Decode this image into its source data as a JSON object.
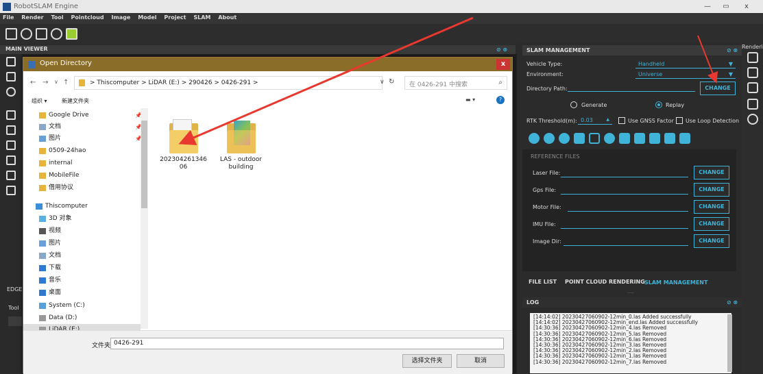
{
  "app": {
    "window_title": "RobotSLAM Engine",
    "window_buttons": {
      "minimize": "—",
      "restore": "▭",
      "close": "x"
    }
  },
  "menubar": {
    "items": [
      "File",
      "Render",
      "Tool",
      "Pointcloud",
      "Image",
      "Model",
      "Project",
      "SLAM",
      "About"
    ]
  },
  "main_viewer": {
    "title": "MAIN VIEWER",
    "edge_label": "EDGE",
    "tool_label": "Tool"
  },
  "dialog": {
    "title": "Open Directory",
    "close": "x",
    "nav": {
      "back": "←",
      "forward": "→",
      "dropdown": "∨",
      "up": "↑"
    },
    "breadcrumb": [
      "Thiscomputer",
      "LiDAR (E:)",
      "290426",
      "0426-291"
    ],
    "breadcrumb_sep": ">",
    "path_chevron": "∨",
    "refresh": "↻",
    "search_placeholder": "在 0426-291 中搜索",
    "search_icon": "⌕",
    "cmd_organize": "组织 ▾",
    "cmd_new_folder": "新建文件夹",
    "view_toggle": "▬ ▾",
    "help": "?",
    "nav_items": [
      {
        "label": "Google Drive",
        "pin": "📌"
      },
      {
        "label": "文档",
        "pin": "📌"
      },
      {
        "label": "图片",
        "pin": "📌"
      },
      {
        "label": "0509-24hao",
        "pin": ""
      },
      {
        "label": "internal",
        "pin": ""
      },
      {
        "label": "MobileFile",
        "pin": ""
      },
      {
        "label": "借用协议",
        "pin": ""
      },
      {
        "label": "Thiscomputer",
        "pin": ""
      },
      {
        "label": "3D 对象",
        "pin": ""
      },
      {
        "label": "视频",
        "pin": ""
      },
      {
        "label": "图片",
        "pin": ""
      },
      {
        "label": "文档",
        "pin": ""
      },
      {
        "label": "下载",
        "pin": ""
      },
      {
        "label": "音乐",
        "pin": ""
      },
      {
        "label": "桌面",
        "pin": ""
      },
      {
        "label": "System (C:)",
        "pin": ""
      },
      {
        "label": "Data (D:)",
        "pin": ""
      },
      {
        "label": "LiDAR (E:)",
        "pin": ""
      }
    ],
    "files": [
      {
        "name_line1": "202304261346",
        "name_line2": "06"
      },
      {
        "name_line1": "LAS - outdoor",
        "name_line2": "building"
      }
    ],
    "folder_label": "文件夹:",
    "folder_value": "0426-291",
    "select_button": "选择文件夹",
    "cancel_button": "取消"
  },
  "slam": {
    "title": "SLAM MANAGEMENT",
    "header_icons": "⊘ ⊗",
    "vehicle_type_label": "Vehicle Type:",
    "vehicle_type_value": "Handheld",
    "environment_label": "Environment:",
    "environment_value": "Universe",
    "directory_path_label": "Directory Path:",
    "change": "CHANGE",
    "generate_label": "Generate",
    "replay_label": "Replay",
    "rtk_label": "RTK Threshold(m):",
    "rtk_value": "0.03",
    "use_gnss_label": "Use GNSS Factor",
    "use_loop_label": "Use Loop Detection",
    "reference_files_title": "REFERENCE FILES",
    "laser_file_label": "Laser File:",
    "gps_file_label": "Gps File:",
    "motor_file_label": "Motor File:",
    "imu_file_label": "IMU File:",
    "image_dir_label": "Image Dir:",
    "tabs": [
      "FILE LIST",
      "POINT CLOUD RENDERING",
      "SLAM MANAGEMENT"
    ],
    "tab_dots": "....."
  },
  "right_strip": {
    "label": "Renderin"
  },
  "log": {
    "title": "LOG",
    "header_icons": "⊘ ⊗",
    "lines": [
      "[14:14:02] 20230427060902-12min_0.las Added successfully",
      "[14:14:02] 20230427060902-12min_end.las Added successfully",
      "[14:30:36] 20230427060902-12min_4.las Removed",
      "[14:30:36] 20230427060902-12min_5.las Removed",
      "[14:30:36] 20230427060902-12min_6.las Removed",
      "[14:30:36] 20230427060902-12min_3.las Removed",
      "[14:30:36] 20230427060902-12min_2.las Removed",
      "[14:30:36] 20230427060902-12min_1.las Removed",
      "[14:30:36] 20230427060902-12min_7.las Removed"
    ]
  },
  "colors": {
    "accent": "#3fb3d8",
    "dialog_title": "#8a6d28",
    "arrow": "#e8382f"
  }
}
